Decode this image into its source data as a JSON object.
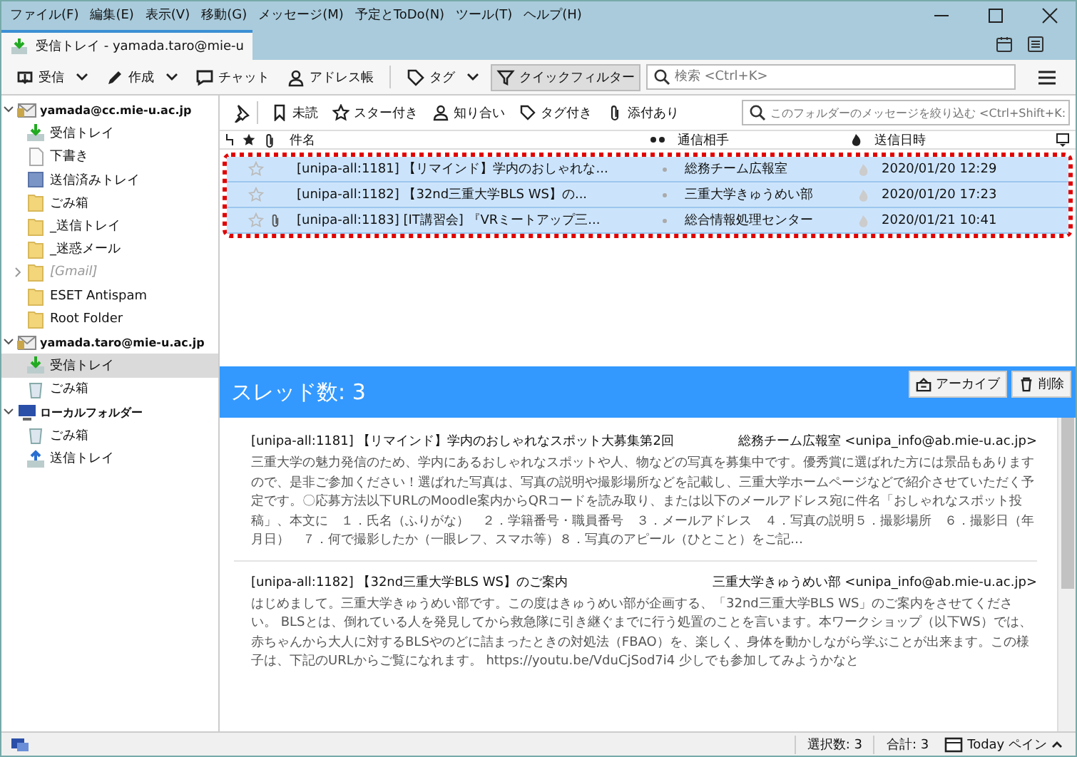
{
  "menu": [
    "ファイル(F)",
    "編集(E)",
    "表示(V)",
    "移動(G)",
    "メッセージ(M)",
    "予定とToDo(N)",
    "ツール(T)",
    "ヘルプ(H)"
  ],
  "tab": {
    "title": "受信トレイ - yamada.taro@mie-u"
  },
  "toolbar": [
    {
      "label": "受信",
      "kind": "get",
      "dropdown": true,
      "selected": false
    },
    {
      "label": "作成",
      "kind": "write",
      "dropdown": true,
      "selected": false
    },
    {
      "label": "チャット",
      "kind": "chat",
      "dropdown": false,
      "selected": false
    },
    {
      "label": "アドレス帳",
      "kind": "contacts",
      "dropdown": false,
      "selected": false
    },
    {
      "label": "タグ",
      "kind": "tag",
      "dropdown": true,
      "selected": false
    },
    {
      "label": "クイックフィルター",
      "kind": "filter",
      "dropdown": false,
      "selected": true
    }
  ],
  "search": {
    "placeholder": "検索 <Ctrl+K>"
  },
  "sidebar": [
    {
      "label": "yamada@cc.mie-u.ac.jp",
      "kind": "account",
      "expanded": true,
      "selected": false,
      "children": [
        {
          "label": "受信トレイ",
          "kind": "inbox",
          "selected": false
        },
        {
          "label": "下書き",
          "kind": "drafts",
          "selected": false
        },
        {
          "label": "送信済みトレイ",
          "kind": "sent",
          "selected": false
        },
        {
          "label": "ごみ箱",
          "kind": "folder",
          "selected": false
        },
        {
          "label": "_送信トレイ",
          "kind": "folder",
          "selected": false
        },
        {
          "label": "_迷惑メール",
          "kind": "folder",
          "selected": false
        },
        {
          "label": "[Gmail]",
          "kind": "folder",
          "selected": false,
          "expandable": true,
          "disabled": true
        },
        {
          "label": "ESET Antispam",
          "kind": "folder",
          "selected": false
        },
        {
          "label": "Root Folder",
          "kind": "folder",
          "selected": false
        }
      ]
    },
    {
      "label": "yamada.taro@mie-u.ac.jp",
      "kind": "account",
      "expanded": true,
      "selected": false,
      "children": [
        {
          "label": "受信トレイ",
          "kind": "inbox",
          "selected": true
        },
        {
          "label": "ごみ箱",
          "kind": "trash",
          "selected": false
        }
      ]
    },
    {
      "label": "ローカルフォルダー",
      "kind": "local",
      "expanded": true,
      "selected": false,
      "children": [
        {
          "label": "ごみ箱",
          "kind": "trash",
          "selected": false
        },
        {
          "label": "送信トレイ",
          "kind": "outbox",
          "selected": false
        }
      ]
    }
  ],
  "filters": [
    {
      "label": "未読",
      "kind": "unread"
    },
    {
      "label": "スター付き",
      "kind": "star"
    },
    {
      "label": "知り合い",
      "kind": "contact"
    },
    {
      "label": "タグ付き",
      "kind": "tag"
    },
    {
      "label": "添付あり",
      "kind": "attach"
    }
  ],
  "filter_search": {
    "placeholder": "このフォルダーのメッセージを絞り込む <Ctrl+Shift+K:"
  },
  "columns": [
    "件名",
    "通信相手",
    "送信日時"
  ],
  "rows": [
    {
      "subject": "[unipa-all:1181] 【リマインド】学内のおしゃれな...",
      "correspondent": "総務チーム広報室",
      "date": "2020/01/20 12:29",
      "starred": false,
      "attachment": false,
      "selected": true
    },
    {
      "subject": "[unipa-all:1182] 【32nd三重大学BLS WS】の...",
      "correspondent": "三重大学きゅうめい部",
      "date": "2020/01/20 17:23",
      "starred": false,
      "attachment": false,
      "selected": true
    },
    {
      "subject": "[unipa-all:1183] [IT講習会] 『VRミートアップ三...",
      "correspondent": "総合情報処理センター",
      "date": "2020/01/21 10:41",
      "starred": false,
      "attachment": true,
      "selected": true
    }
  ],
  "preview": {
    "title": "スレッド数: 3",
    "buttons": [
      {
        "label": "アーカイブ",
        "kind": "archive"
      },
      {
        "label": "削除",
        "kind": "delete"
      }
    ],
    "messages": [
      {
        "subject": "[unipa-all:1181] 【リマインド】学内のおしゃれなスポット大募集第2回",
        "from": "総務チーム広報室 <unipa_info@ab.mie-u.ac.jp>",
        "body": "三重大学の魅力発信のため、学内にあるおしゃれなスポットや人、物などの写真を募集中です。優秀賞に選ばれた方には景品もありますので、是非ご参加ください！選ばれた写真は、写真の説明や撮影場所などを記載し、三重大学ホームページなどで紹介させていただく予定です。〇応募方法以下URLのMoodle案内からQRコードを読み取り、または以下のメールアドレス宛に件名「おしゃれなスポット投稿」、本文に　１．氏名（ふりがな）　２．学籍番号・職員番号　３．メールアドレス　４．写真の説明５．撮影場所　６．撮影日（年月日）　７．何で撮影したか（一眼レフ、スマホ等）８．写真のアピール（ひとこと）をご記…"
      },
      {
        "subject": "[unipa-all:1182] 【32nd三重大学BLS WS】のご案内",
        "from": "三重大学きゅうめい部 <unipa_info@ab.mie-u.ac.jp>",
        "body": "はじめまして。三重大学きゅうめい部です。この度はきゅうめい部が企画する、「32nd三重大学BLS WS」のご案内をさせてください。 BLSとは、倒れている人を発見してから救急隊に引き継ぐまでに行う処置のことを言います。本ワークショップ（以下WS）では、赤ちゃんから大人に対するBLSやのどに詰まったときの対処法（FBAO）を、楽しく、身体を動かしながら学ぶことが出来ます。この様子は、下記のURLからご覧になれます。 https://youtu.be/VduCjSod7i4 少しでも参加してみようかなと"
      }
    ]
  },
  "status": {
    "selected": "選択数: 3",
    "total": "合計: 3",
    "today": "Today ペイン"
  }
}
